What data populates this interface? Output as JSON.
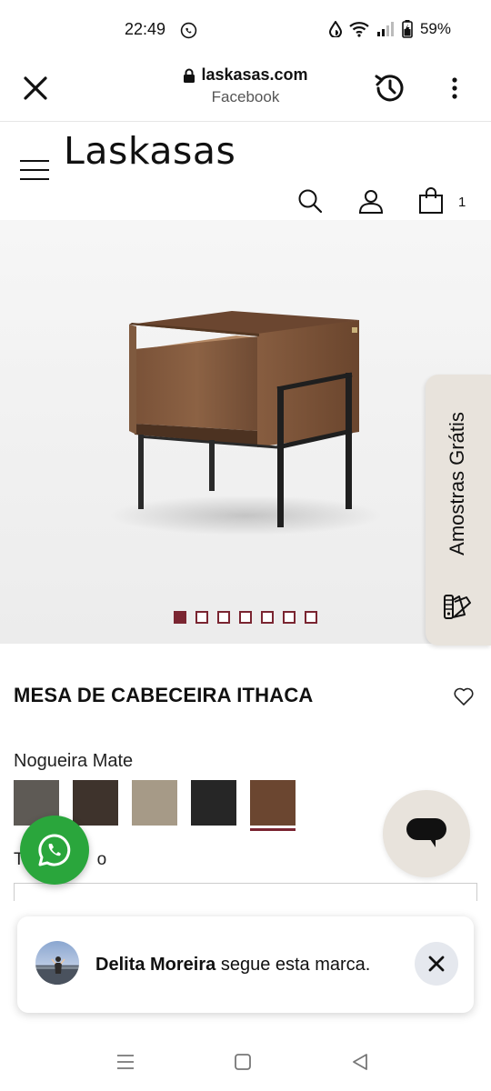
{
  "status_bar": {
    "time": "22:49",
    "battery_percent": "59%",
    "icons": [
      "whatsapp-icon",
      "data-saver-icon",
      "wifi-icon",
      "signal-icon",
      "battery-charging-icon"
    ]
  },
  "browser": {
    "domain": "laskasas.com",
    "referrer": "Facebook",
    "icons": [
      "close-icon",
      "lock-icon",
      "history-icon",
      "more-vertical-icon"
    ]
  },
  "site_header": {
    "logo_text": "Laskasas",
    "cart_count": "1",
    "icons": [
      "hamburger-menu-icon",
      "search-icon",
      "user-icon",
      "shopping-bag-icon"
    ]
  },
  "gallery": {
    "total_images": 7,
    "active_index": 0
  },
  "samples_tab": {
    "label": "Amostras Grátis",
    "icon": "color-swatch-fan-icon"
  },
  "product": {
    "title": "MESA DE CABECEIRA ITHACA",
    "finish_label": "Nogueira Mate",
    "size_label_partial": "T",
    "size_label_end": "o",
    "swatches": [
      {
        "color": "#5e5a55",
        "selected": false
      },
      {
        "color": "#3e332c",
        "selected": false
      },
      {
        "color": "#a69a87",
        "selected": false
      },
      {
        "color": "#262626",
        "selected": false
      },
      {
        "color": "#6b4630",
        "selected": true
      }
    ]
  },
  "notification": {
    "name": "Delita Moreira",
    "message": "segue esta marca."
  },
  "colors": {
    "accent": "#7a2531",
    "samples_bg": "#e8e3dc",
    "whatsapp_green": "#2aa63c"
  }
}
